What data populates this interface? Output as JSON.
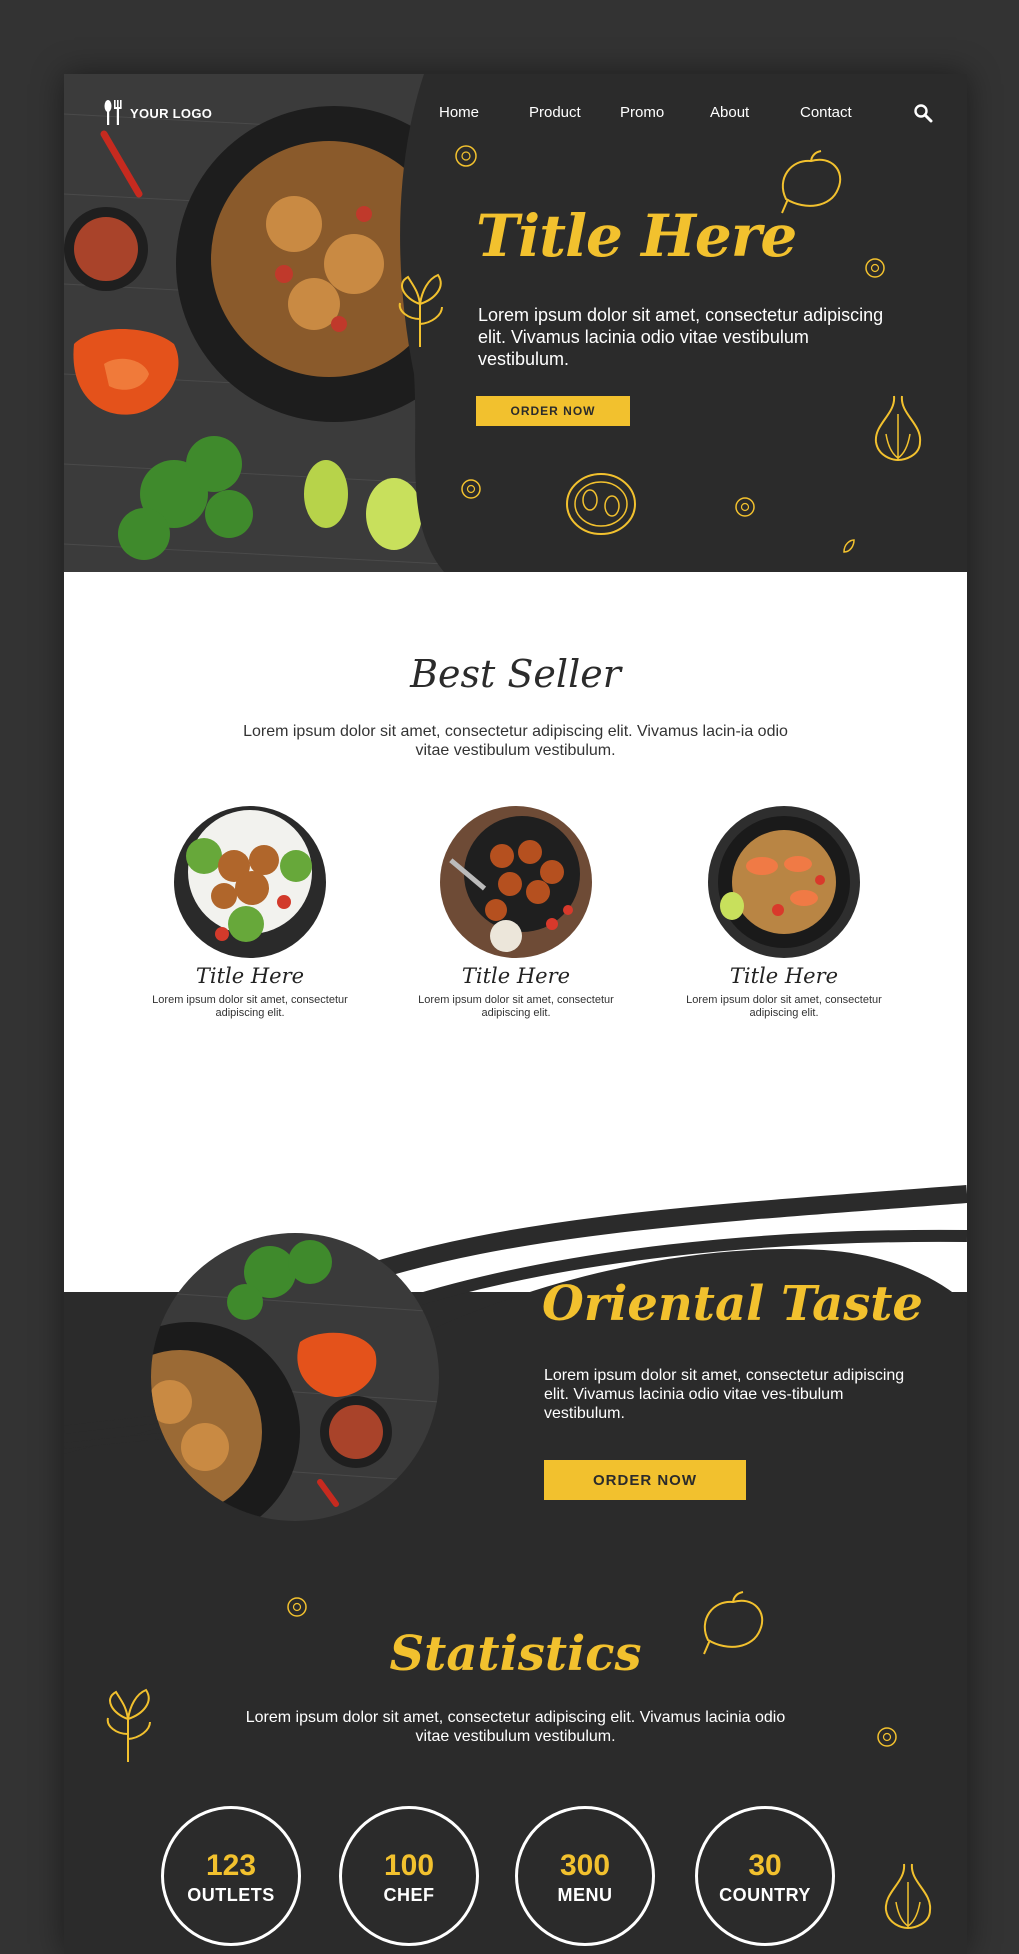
{
  "header": {
    "logo_text": "YOUR LOGO",
    "nav": [
      "Home",
      "Product",
      "Promo",
      "About",
      "Contact"
    ]
  },
  "hero": {
    "title": "Title Here",
    "text": "Lorem ipsum dolor sit amet, consectetur adipiscing elit. Vivamus lacinia odio vitae vestibulum vestibulum.",
    "button": "ORDER NOW"
  },
  "best_seller": {
    "title": "Best Seller",
    "text": "Lorem ipsum dolor sit amet, consectetur adipiscing elit. Vivamus lacin-ia odio vitae vestibulum vestibulum.",
    "items": [
      {
        "title": "Title Here",
        "text": "Lorem ipsum dolor sit amet, consectetur adipiscing elit."
      },
      {
        "title": "Title Here",
        "text": "Lorem ipsum dolor sit amet, consectetur adipiscing elit."
      },
      {
        "title": "Title Here",
        "text": "Lorem ipsum dolor sit amet, consectetur adipiscing elit."
      }
    ]
  },
  "oriental": {
    "title": "Oriental Taste",
    "text": "Lorem ipsum dolor sit amet, consectetur adipiscing elit. Vivamus lacinia odio vitae ves-tibulum vestibulum.",
    "button": "ORDER NOW"
  },
  "statistics": {
    "title": "Statistics",
    "text": "Lorem ipsum dolor sit amet, consectetur adipiscing elit. Vivamus lacinia odio vitae vestibulum vestibulum.",
    "items": [
      {
        "value": "123",
        "label": "OUTLETS"
      },
      {
        "value": "100",
        "label": "CHEF"
      },
      {
        "value": "300",
        "label": "MENU"
      },
      {
        "value": "30",
        "label": "COUNTRY"
      }
    ]
  },
  "colors": {
    "accent": "#f2c12e",
    "dark": "#2b2b2b",
    "light": "#ffffff"
  },
  "icons": [
    "fork-spoon-icon",
    "search-icon"
  ]
}
